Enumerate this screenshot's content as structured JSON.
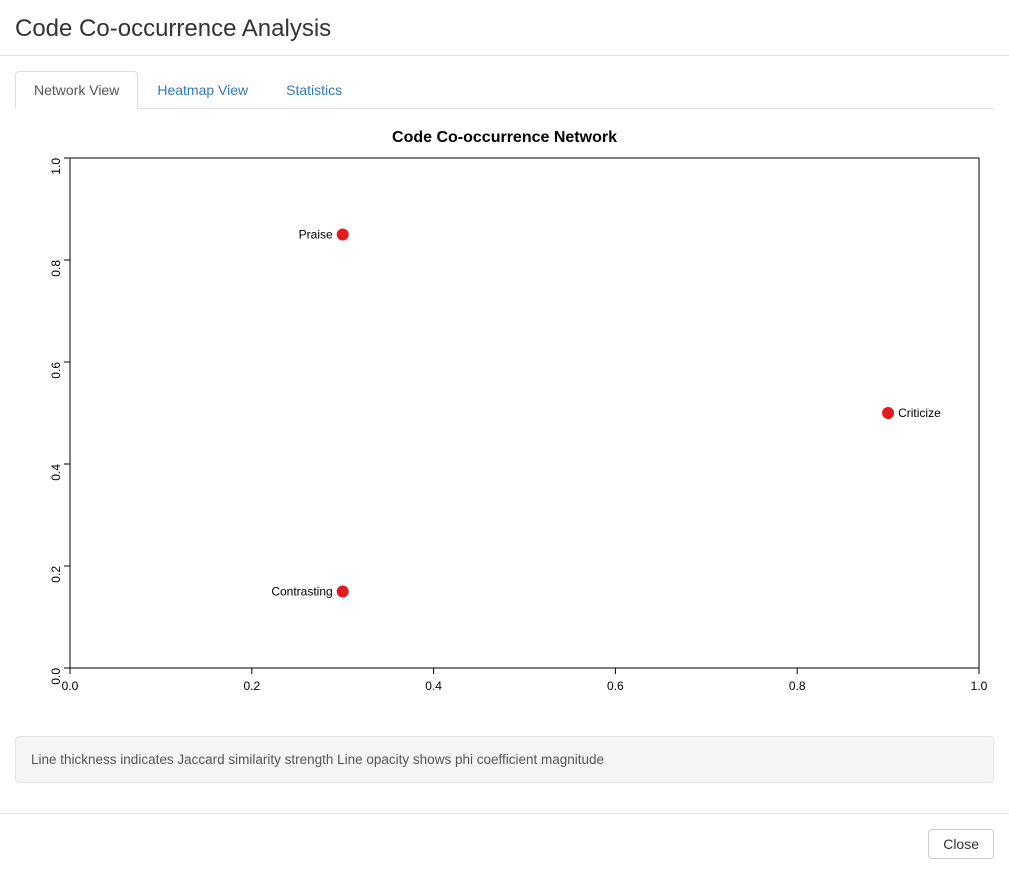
{
  "header": {
    "title": "Code Co-occurrence Analysis"
  },
  "tabs": {
    "items": [
      {
        "label": "Network View",
        "active": true
      },
      {
        "label": "Heatmap View",
        "active": false
      },
      {
        "label": "Statistics",
        "active": false
      }
    ]
  },
  "chart_data": {
    "type": "scatter",
    "title": "Code Co-occurrence Network",
    "xlabel": "",
    "ylabel": "",
    "xlim": [
      0.0,
      1.0
    ],
    "ylim": [
      0.0,
      1.0
    ],
    "xticks": [
      "0.0",
      "0.2",
      "0.4",
      "0.6",
      "0.8",
      "1.0"
    ],
    "yticks": [
      "0.0",
      "0.2",
      "0.4",
      "0.6",
      "0.8",
      "1.0"
    ],
    "nodes": [
      {
        "label": "Praise",
        "x": 0.3,
        "y": 0.85,
        "label_side": "left"
      },
      {
        "label": "Criticize",
        "x": 0.9,
        "y": 0.5,
        "label_side": "right"
      },
      {
        "label": "Contrasting",
        "x": 0.3,
        "y": 0.15,
        "label_side": "left"
      }
    ],
    "edges": []
  },
  "caption": {
    "text": "Line thickness indicates Jaccard similarity strength Line opacity shows phi coefficient magnitude"
  },
  "footer": {
    "close_label": "Close"
  }
}
